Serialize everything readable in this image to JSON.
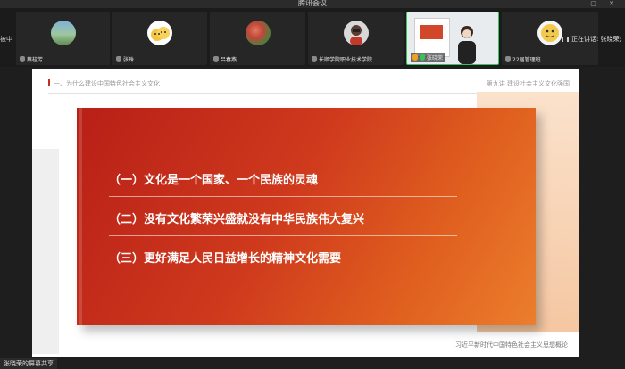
{
  "window": {
    "title": "腾讯会议",
    "controls": "— ▢ ✕"
  },
  "strip": {
    "left_edge_text": "被中",
    "participants": [
      {
        "name": "蔡桂芳"
      },
      {
        "name": "张珠"
      },
      {
        "name": "吕春燕"
      },
      {
        "name": "长顺学院职业技术学院"
      },
      {
        "name": "张晓荣"
      },
      {
        "name": "22届管理班"
      }
    ],
    "speaking_label": "正在讲话: 张晓荣;"
  },
  "slide": {
    "section": "一、为什么建设中国特色社会主义文化",
    "lecture": "第九讲  建设社会主义文化强国",
    "points": [
      "（一）文化是一个国家、一个民族的灵魂",
      "（二）没有文化繁荣兴盛就没有中华民族伟大复兴",
      "（三）更好满足人民日益增长的精神文化需要"
    ],
    "footer": "习近平新时代中国特色社会主义思想概论"
  },
  "share": {
    "label": "张晓荣的屏幕共享"
  },
  "colors": {
    "accent": "#c5301c",
    "card_start": "#b81f17",
    "card_end": "#ec7e2d"
  }
}
